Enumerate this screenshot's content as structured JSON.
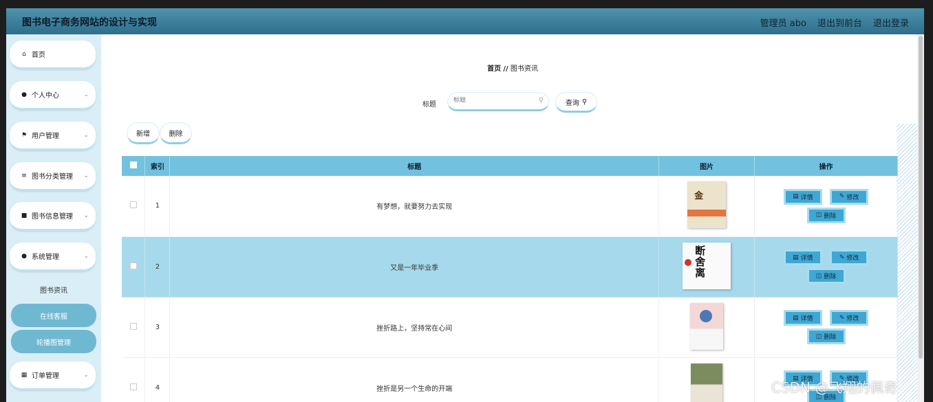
{
  "header": {
    "app_title": "图书电子商务网站的设计与实现",
    "admin_label": "管理员 abo",
    "back_to_front": "退出到前台",
    "logout": "退出登录"
  },
  "sidebar": {
    "items": [
      {
        "label": "首页",
        "icon": "home-icon"
      },
      {
        "label": "个人中心",
        "icon": "user-icon"
      },
      {
        "label": "用户管理",
        "icon": "flag-icon"
      },
      {
        "label": "图书分类管理",
        "icon": "sliders-icon"
      },
      {
        "label": "图书信息管理",
        "icon": "message-icon"
      },
      {
        "label": "系统管理",
        "icon": "user-icon"
      },
      {
        "label": "订单管理",
        "icon": "grid-icon"
      }
    ],
    "sub_items": [
      "图书资讯",
      "在线客服",
      "轮播图管理"
    ]
  },
  "breadcrumb": {
    "home": "首页",
    "sep": "//",
    "current": "图书资讯"
  },
  "search": {
    "label": "标题",
    "placeholder": "标题",
    "button": "查询"
  },
  "actions": {
    "add": "新增",
    "delete": "删除"
  },
  "table": {
    "headers": [
      "索引",
      "标题",
      "图片",
      "操作"
    ],
    "rows": [
      {
        "index": "1",
        "title": "有梦想，就要努力去实现",
        "image": "book-cover-jinyan"
      },
      {
        "index": "2",
        "title": "又是一年毕业季",
        "image": "book-cover-duansheli"
      },
      {
        "index": "3",
        "title": "挫折路上，坚持常在心间",
        "image": "book-cover-pink-flower"
      },
      {
        "index": "4",
        "title": "挫折是另一个生命的开端",
        "image": "book-cover-photo"
      }
    ],
    "row_actions": {
      "detail": "详情",
      "edit": "修改",
      "delete": "删除"
    }
  },
  "watermark": "CSDN @飞翔的佩奇",
  "colors": {
    "topbar": "#3f86a3",
    "header_row": "#72c1df",
    "selected_row": "#a7d9ec",
    "action_button": "#3fa7d3",
    "sidebar_active": "#6fb8d2"
  }
}
